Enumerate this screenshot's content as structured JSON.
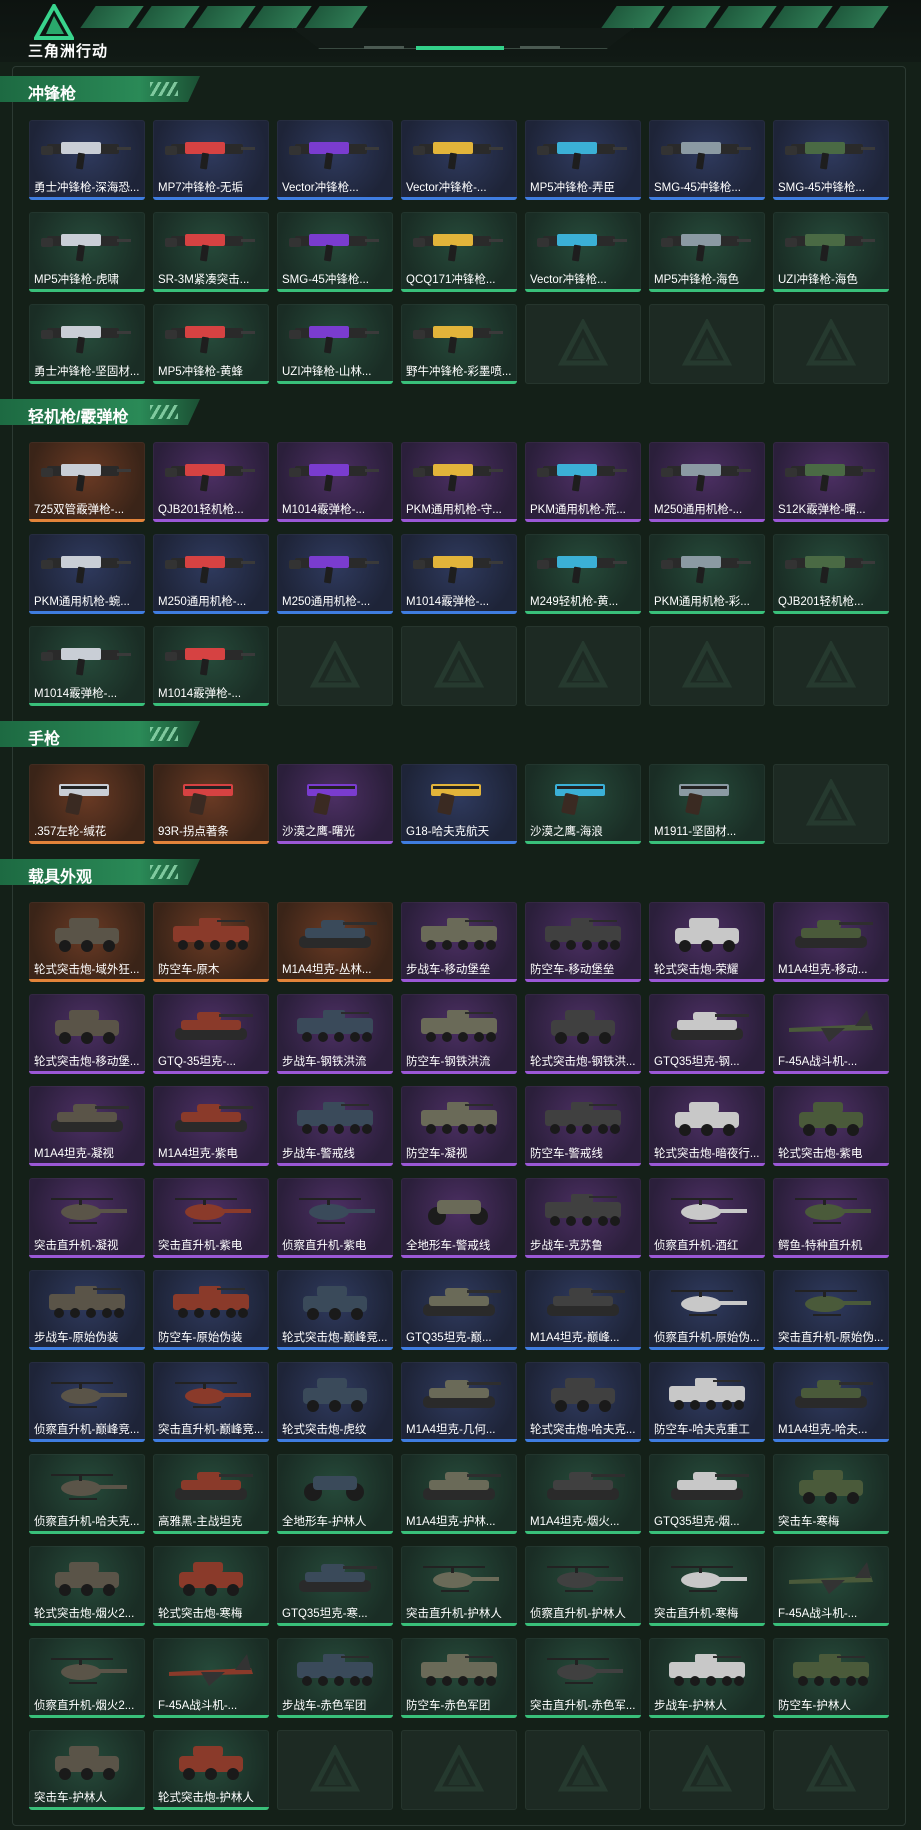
{
  "brand": {
    "title": "三角洲行动"
  },
  "colors": {
    "orange": "#e2843a",
    "purple": "#9b58d6",
    "blue": "#3f7de0",
    "green": "#39c07a",
    "accent": "#33d18a"
  },
  "sections": [
    {
      "title": "冲锋枪",
      "kind": "gun",
      "items": [
        {
          "label": "勇士冲锋枪-深海恐...",
          "rarity": "blue"
        },
        {
          "label": "MP7冲锋枪-无垢",
          "rarity": "blue"
        },
        {
          "label": "Vector冲锋枪...",
          "rarity": "blue"
        },
        {
          "label": "Vector冲锋枪-...",
          "rarity": "blue"
        },
        {
          "label": "MP5冲锋枪-弄臣",
          "rarity": "blue"
        },
        {
          "label": "SMG-45冲锋枪...",
          "rarity": "blue"
        },
        {
          "label": "SMG-45冲锋枪...",
          "rarity": "blue"
        },
        {
          "label": "MP5冲锋枪-虎啸",
          "rarity": "green"
        },
        {
          "label": "SR-3M紧凑突击...",
          "rarity": "green"
        },
        {
          "label": "SMG-45冲锋枪...",
          "rarity": "green"
        },
        {
          "label": "QCQ171冲锋枪...",
          "rarity": "green"
        },
        {
          "label": "Vector冲锋枪...",
          "rarity": "green"
        },
        {
          "label": "MP5冲锋枪-海色",
          "rarity": "green"
        },
        {
          "label": "UZI冲锋枪-海色",
          "rarity": "green"
        },
        {
          "label": "勇士冲锋枪-坚固材...",
          "rarity": "green"
        },
        {
          "label": "MP5冲锋枪-黄蜂",
          "rarity": "green"
        },
        {
          "label": "UZI冲锋枪-山林...",
          "rarity": "green"
        },
        {
          "label": "野牛冲锋枪-彩墨喷...",
          "rarity": "green"
        },
        {
          "empty": true
        },
        {
          "empty": true
        },
        {
          "empty": true
        }
      ]
    },
    {
      "title": "轻机枪/霰弹枪",
      "kind": "gun",
      "items": [
        {
          "label": "725双管霰弹枪-...",
          "rarity": "orange"
        },
        {
          "label": "QJB201轻机枪...",
          "rarity": "purple"
        },
        {
          "label": "M1014霰弹枪-...",
          "rarity": "purple"
        },
        {
          "label": "PKM通用机枪-守...",
          "rarity": "purple"
        },
        {
          "label": "PKM通用机枪-荒...",
          "rarity": "purple"
        },
        {
          "label": "M250通用机枪-...",
          "rarity": "purple"
        },
        {
          "label": "S12K霰弹枪-曙...",
          "rarity": "purple"
        },
        {
          "label": "PKM通用机枪-蜿...",
          "rarity": "blue"
        },
        {
          "label": "M250通用机枪-...",
          "rarity": "blue"
        },
        {
          "label": "M250通用机枪-...",
          "rarity": "blue"
        },
        {
          "label": "M1014霰弹枪-...",
          "rarity": "blue"
        },
        {
          "label": "M249轻机枪-黄...",
          "rarity": "green"
        },
        {
          "label": "PKM通用机枪-彩...",
          "rarity": "green"
        },
        {
          "label": "QJB201轻机枪...",
          "rarity": "green"
        },
        {
          "label": "M1014霰弹枪-...",
          "rarity": "green"
        },
        {
          "label": "M1014霰弹枪-...",
          "rarity": "green"
        },
        {
          "empty": true
        },
        {
          "empty": true
        },
        {
          "empty": true
        },
        {
          "empty": true
        },
        {
          "empty": true
        }
      ]
    },
    {
      "title": "手枪",
      "kind": "pistol",
      "items": [
        {
          "label": ".357左轮-缄花",
          "rarity": "orange"
        },
        {
          "label": "93R-拐点著条",
          "rarity": "orange"
        },
        {
          "label": "沙漠之鹰-曙光",
          "rarity": "purple"
        },
        {
          "label": "G18-哈夫克航天",
          "rarity": "blue"
        },
        {
          "label": "沙漠之鹰-海浪",
          "rarity": "green"
        },
        {
          "label": "M1911-坚固材...",
          "rarity": "green"
        },
        {
          "empty": true
        }
      ]
    },
    {
      "title": "载具外观",
      "kind": "vehicle",
      "items": [
        {
          "label": "轮式突击炮-域外狂...",
          "rarity": "orange",
          "v": "car"
        },
        {
          "label": "防空车-原木",
          "rarity": "orange",
          "v": "apc"
        },
        {
          "label": "M1A4坦克-丛林...",
          "rarity": "orange",
          "v": "tank"
        },
        {
          "label": "步战车-移动堡垒",
          "rarity": "purple",
          "v": "apc"
        },
        {
          "label": "防空车-移动堡垒",
          "rarity": "purple",
          "v": "apc"
        },
        {
          "label": "轮式突击炮-荣耀",
          "rarity": "purple",
          "v": "car"
        },
        {
          "label": "M1A4坦克-移动...",
          "rarity": "purple",
          "v": "tank"
        },
        {
          "label": "轮式突击炮-移动堡...",
          "rarity": "purple",
          "v": "car"
        },
        {
          "label": "GTQ-35坦克-...",
          "rarity": "purple",
          "v": "tank"
        },
        {
          "label": "步战车-钢铁洪流",
          "rarity": "purple",
          "v": "apc"
        },
        {
          "label": "防空车-钢铁洪流",
          "rarity": "purple",
          "v": "apc"
        },
        {
          "label": "轮式突击炮-钢铁洪...",
          "rarity": "purple",
          "v": "car"
        },
        {
          "label": "GTQ35坦克-钢...",
          "rarity": "purple",
          "v": "tank"
        },
        {
          "label": "F-45A战斗机-...",
          "rarity": "purple",
          "v": "jet"
        },
        {
          "label": "M1A4坦克-凝视",
          "rarity": "purple",
          "v": "tank"
        },
        {
          "label": "M1A4坦克-紫电",
          "rarity": "purple",
          "v": "tank"
        },
        {
          "label": "步战车-警戒线",
          "rarity": "purple",
          "v": "apc"
        },
        {
          "label": "防空车-凝视",
          "rarity": "purple",
          "v": "apc"
        },
        {
          "label": "防空车-警戒线",
          "rarity": "purple",
          "v": "apc"
        },
        {
          "label": "轮式突击炮-暗夜行...",
          "rarity": "purple",
          "v": "car"
        },
        {
          "label": "轮式突击炮-紫电",
          "rarity": "purple",
          "v": "car"
        },
        {
          "label": "突击直升机-凝视",
          "rarity": "purple",
          "v": "heli"
        },
        {
          "label": "突击直升机-紫电",
          "rarity": "purple",
          "v": "heli"
        },
        {
          "label": "侦察直升机-紫电",
          "rarity": "purple",
          "v": "heli"
        },
        {
          "label": "全地形车-警戒线",
          "rarity": "purple",
          "v": "atv"
        },
        {
          "label": "步战车-克苏鲁",
          "rarity": "purple",
          "v": "apc"
        },
        {
          "label": "侦察直升机-酒红",
          "rarity": "purple",
          "v": "heli"
        },
        {
          "label": "鳄鱼-特种直升机",
          "rarity": "purple",
          "v": "heli"
        },
        {
          "label": "步战车-原始伪装",
          "rarity": "blue",
          "v": "apc"
        },
        {
          "label": "防空车-原始伪装",
          "rarity": "blue",
          "v": "apc"
        },
        {
          "label": "轮式突击炮-巅峰竞...",
          "rarity": "blue",
          "v": "car"
        },
        {
          "label": "GTQ35坦克-巅...",
          "rarity": "blue",
          "v": "tank"
        },
        {
          "label": "M1A4坦克-巅峰...",
          "rarity": "blue",
          "v": "tank"
        },
        {
          "label": "侦察直升机-原始伪...",
          "rarity": "blue",
          "v": "heli"
        },
        {
          "label": "突击直升机-原始伪...",
          "rarity": "blue",
          "v": "heli"
        },
        {
          "label": "侦察直升机-巅峰竞...",
          "rarity": "blue",
          "v": "heli"
        },
        {
          "label": "突击直升机-巅峰竞...",
          "rarity": "blue",
          "v": "heli"
        },
        {
          "label": "轮式突击炮-虎纹",
          "rarity": "blue",
          "v": "car"
        },
        {
          "label": "M1A4坦克-几何...",
          "rarity": "blue",
          "v": "tank"
        },
        {
          "label": "轮式突击炮-哈夫克...",
          "rarity": "blue",
          "v": "car"
        },
        {
          "label": "防空车-哈夫克重工",
          "rarity": "blue",
          "v": "apc"
        },
        {
          "label": "M1A4坦克-哈夫...",
          "rarity": "blue",
          "v": "tank"
        },
        {
          "label": "侦察直升机-哈夫克...",
          "rarity": "green",
          "v": "heli"
        },
        {
          "label": "高雅黑-主战坦克",
          "rarity": "green",
          "v": "tank"
        },
        {
          "label": "全地形车-护林人",
          "rarity": "green",
          "v": "atv"
        },
        {
          "label": "M1A4坦克-护林...",
          "rarity": "green",
          "v": "tank"
        },
        {
          "label": "M1A4坦克-烟火...",
          "rarity": "green",
          "v": "tank"
        },
        {
          "label": "GTQ35坦克-烟...",
          "rarity": "green",
          "v": "tank"
        },
        {
          "label": "突击车-寒梅",
          "rarity": "green",
          "v": "car"
        },
        {
          "label": "轮式突击炮-烟火2...",
          "rarity": "green",
          "v": "car"
        },
        {
          "label": "轮式突击炮-寒梅",
          "rarity": "green",
          "v": "car"
        },
        {
          "label": "GTQ35坦克-寒...",
          "rarity": "green",
          "v": "tank"
        },
        {
          "label": "突击直升机-护林人",
          "rarity": "green",
          "v": "heli"
        },
        {
          "label": "侦察直升机-护林人",
          "rarity": "green",
          "v": "heli"
        },
        {
          "label": "突击直升机-寒梅",
          "rarity": "green",
          "v": "heli"
        },
        {
          "label": "F-45A战斗机-...",
          "rarity": "green",
          "v": "jet"
        },
        {
          "label": "侦察直升机-烟火2...",
          "rarity": "green",
          "v": "heli"
        },
        {
          "label": "F-45A战斗机-...",
          "rarity": "green",
          "v": "jet"
        },
        {
          "label": "步战车-赤色军团",
          "rarity": "green",
          "v": "apc"
        },
        {
          "label": "防空车-赤色军团",
          "rarity": "green",
          "v": "apc"
        },
        {
          "label": "突击直升机-赤色军...",
          "rarity": "green",
          "v": "heli"
        },
        {
          "label": "步战车-护林人",
          "rarity": "green",
          "v": "apc"
        },
        {
          "label": "防空车-护林人",
          "rarity": "green",
          "v": "apc"
        },
        {
          "label": "突击车-护林人",
          "rarity": "green",
          "v": "car"
        },
        {
          "label": "轮式突击炮-护林人",
          "rarity": "green",
          "v": "car"
        },
        {
          "empty": true
        },
        {
          "empty": true
        },
        {
          "empty": true
        },
        {
          "empty": true
        },
        {
          "empty": true
        }
      ]
    }
  ]
}
